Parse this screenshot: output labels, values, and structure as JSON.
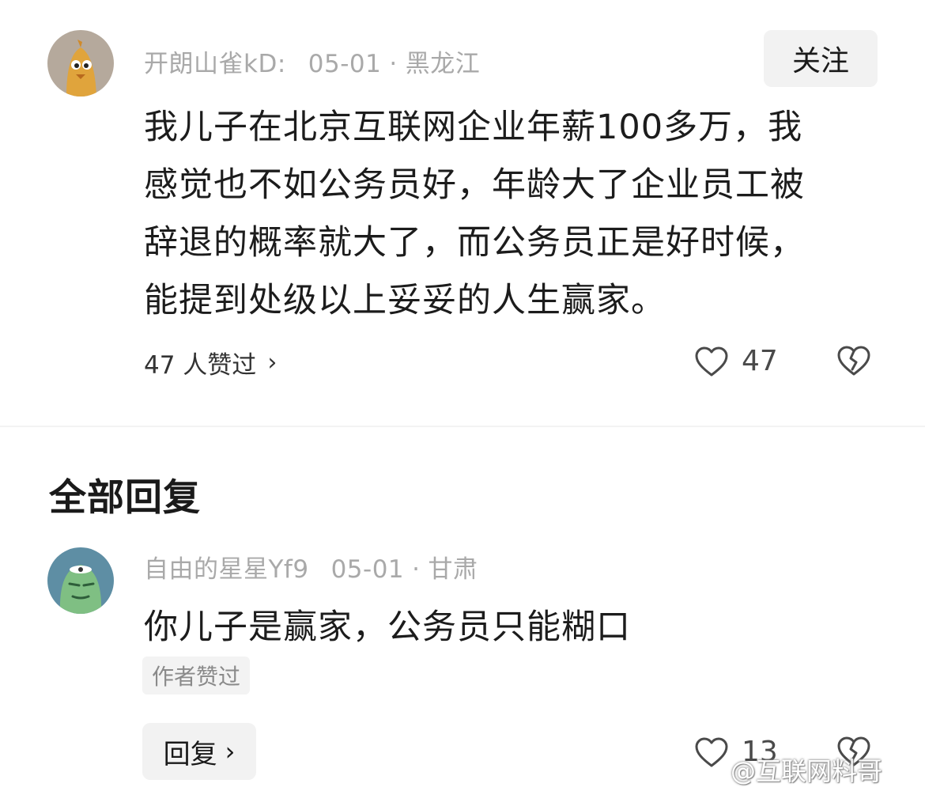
{
  "post": {
    "author": "开朗山雀kD:",
    "date": "05-01",
    "separator": "·",
    "location": "黑龙江",
    "follow_label": "关注",
    "text_lines": [
      "我儿子在北京互联网企业年薪100多万，我",
      "感觉也不如公务员好，年龄大了企业员工被",
      "辞退的概率就大了，而公务员正是好时候，",
      "能提到处级以上妥妥的人生赢家。"
    ],
    "likers_label": "47 人赞过",
    "likers_chevron": "›",
    "like_count": "47"
  },
  "replies_section": {
    "title": "全部回复"
  },
  "reply": {
    "author": "自由的星星Yf9",
    "date": "05-01",
    "separator": "·",
    "location": "甘肃",
    "text": "你儿子是赢家，公务员只能糊口",
    "author_liked_badge": "作者赞过",
    "reply_button_label": "回复",
    "reply_button_chevron": "›",
    "like_count": "13"
  },
  "watermark": "@互联网料哥",
  "colors": {
    "meta_gray": "#a9a9a9",
    "button_bg": "#f2f2f2",
    "text_dark": "#1c1c1c",
    "avatar1_bg": "#b5a99c",
    "avatar2_bg": "#5e8ea4"
  },
  "icons": {
    "avatar1": "cartoon-bird-avatar",
    "avatar2": "cartoon-dinosaur-avatar",
    "like": "heart-outline-icon",
    "dislike": "broken-heart-icon"
  }
}
